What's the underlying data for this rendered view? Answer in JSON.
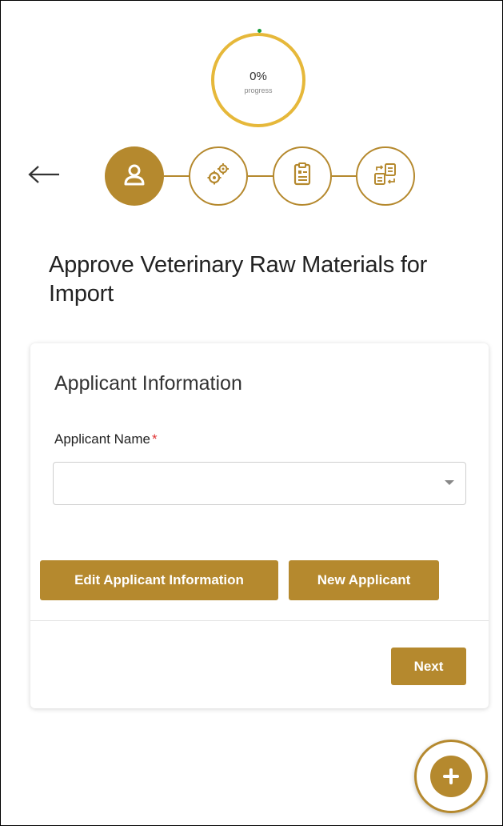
{
  "progress": {
    "value": "0%",
    "caption": "progress",
    "fraction": 0
  },
  "stepper": {
    "active_index": 0,
    "steps": [
      {
        "icon": "user-icon"
      },
      {
        "icon": "gears-icon"
      },
      {
        "icon": "document-icon"
      },
      {
        "icon": "file-transfer-icon"
      }
    ]
  },
  "page": {
    "title": "Approve Veterinary Raw Materials for Import"
  },
  "card": {
    "heading": "Applicant Information",
    "applicant_field": {
      "label": "Applicant Name",
      "required_mark": "*",
      "value": ""
    },
    "edit_button": "Edit Applicant Information",
    "new_button": "New Applicant",
    "next_button": "Next"
  },
  "colors": {
    "accent": "#b5892e",
    "progress_ring": "#e6b83a",
    "required": "#e03030"
  }
}
